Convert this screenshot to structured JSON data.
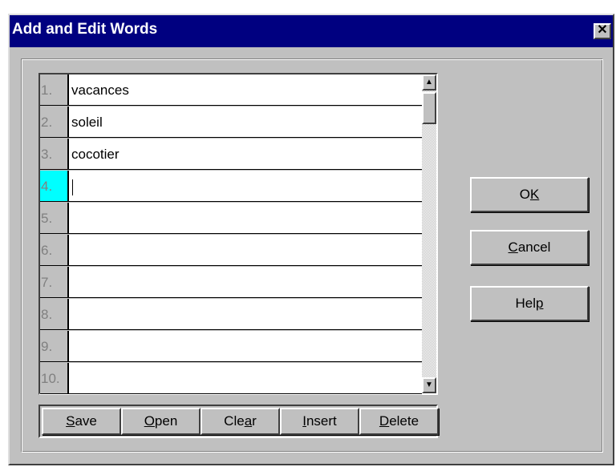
{
  "dialog": {
    "title": "Add and Edit Words",
    "close_glyph": "✕"
  },
  "word_list": {
    "rows": [
      {
        "number": "1.",
        "word": "vacances"
      },
      {
        "number": "2.",
        "word": "soleil"
      },
      {
        "number": "3.",
        "word": "cocotier"
      },
      {
        "number": "4.",
        "word": ""
      },
      {
        "number": "5.",
        "word": ""
      },
      {
        "number": "6.",
        "word": ""
      },
      {
        "number": "7.",
        "word": ""
      },
      {
        "number": "8.",
        "word": ""
      },
      {
        "number": "9.",
        "word": ""
      },
      {
        "number": "10.",
        "word": ""
      }
    ],
    "active_row": 4,
    "active_color": "#00ffff"
  },
  "scrollbar": {
    "up_icon": "▲",
    "down_icon": "▼"
  },
  "list_buttons": {
    "save": {
      "mnemonic": "S",
      "rest": "ave"
    },
    "open": {
      "mnemonic": "O",
      "rest": "pen"
    },
    "clear": {
      "pre": "Cle",
      "mnemonic": "a",
      "rest": "r"
    },
    "insert": {
      "mnemonic": "I",
      "rest": "nsert"
    },
    "delete": {
      "mnemonic": "D",
      "rest": "elete"
    }
  },
  "side_buttons": {
    "ok": {
      "pre": "O",
      "mnemonic": "K",
      "rest": ""
    },
    "cancel": {
      "mnemonic": "C",
      "rest": "ancel"
    },
    "help": {
      "pre": "Hel",
      "mnemonic": "p",
      "rest": ""
    }
  },
  "colors": {
    "title_bar": "#000080",
    "face": "#c0c0c0"
  }
}
